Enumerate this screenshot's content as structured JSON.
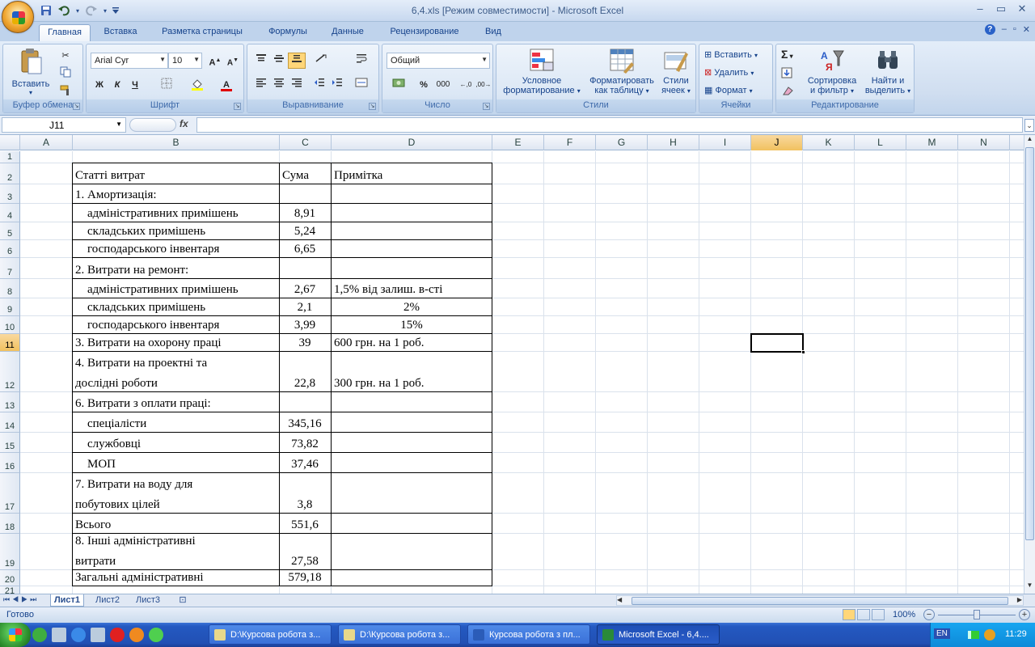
{
  "window": {
    "title": "6,4.xls  [Режим совместимости] - Microsoft Excel",
    "qat_icons": [
      "save-icon",
      "undo-icon",
      "redo-icon",
      "customize-icon"
    ]
  },
  "tabs": [
    "Главная",
    "Вставка",
    "Разметка страницы",
    "Формулы",
    "Данные",
    "Рецензирование",
    "Вид"
  ],
  "ribbon": {
    "clipboard": {
      "paste": "Вставить",
      "label": "Буфер обмена"
    },
    "font": {
      "name": "Arial Cyr",
      "size": "10",
      "bold": "Ж",
      "italic": "К",
      "underline": "Ч",
      "label": "Шрифт"
    },
    "alignment": {
      "label": "Выравнивание"
    },
    "number": {
      "format": "Общий",
      "percent": "%",
      "thousands": "000",
      "label": "Число"
    },
    "styles": {
      "conditional1": "Условное",
      "conditional2": "форматирование",
      "format_table1": "Форматировать",
      "format_table2": "как таблицу",
      "cell_styles1": "Стили",
      "cell_styles2": "ячеек",
      "label": "Стили"
    },
    "cells": {
      "insert": "Вставить",
      "delete": "Удалить",
      "format": "Формат",
      "label": "Ячейки"
    },
    "editing": {
      "sum": "Σ",
      "sort1": "Сортировка",
      "sort2": "и фильтр",
      "find1": "Найти и",
      "find2": "выделить",
      "label": "Редактирование"
    }
  },
  "formula_bar": {
    "name_box": "J11",
    "fx": "fx",
    "value": ""
  },
  "columns": [
    "A",
    "B",
    "C",
    "D",
    "E",
    "F",
    "G",
    "H",
    "I",
    "J",
    "K",
    "L",
    "M",
    "N"
  ],
  "rows": [
    "1",
    "2",
    "3",
    "4",
    "5",
    "6",
    "7",
    "8",
    "9",
    "10",
    "11",
    "12",
    "13",
    "14",
    "15",
    "16",
    "17",
    "18",
    "19",
    "20",
    "21"
  ],
  "cells": {
    "r2": {
      "b": "Статті витрат",
      "c": "Сума",
      "d": "Примітка"
    },
    "r3": {
      "b": "1. Амортизація:",
      "c": "",
      "d": ""
    },
    "r4": {
      "b": "адміністративних примішень",
      "c": "8,91",
      "d": ""
    },
    "r5": {
      "b": "складських примішень",
      "c": "5,24",
      "d": ""
    },
    "r6": {
      "b": "господарського інвентаря",
      "c": "6,65",
      "d": ""
    },
    "r7": {
      "b": "2. Витрати на ремонт:",
      "c": "",
      "d": ""
    },
    "r8": {
      "b": "адміністративних примішень",
      "c": "2,67",
      "d": "1,5% від залиш. в-сті"
    },
    "r9": {
      "b": "складських примішень",
      "c": "2,1",
      "d": "2%"
    },
    "r10": {
      "b": "господарського інвентаря",
      "c": "3,99",
      "d": "15%"
    },
    "r11": {
      "b": "3. Витрати на охорону праці",
      "c": "39",
      "d": "600 грн. на 1 роб."
    },
    "r12": {
      "b1": "4. Витрати на проектні та",
      "b2": "дослідні роботи",
      "c": "22,8",
      "d": "300 грн. на 1 роб."
    },
    "r13": {
      "b": "6. Витрати з оплати праці:",
      "c": "",
      "d": ""
    },
    "r14": {
      "b": "спеціалісти",
      "c": "345,16",
      "d": ""
    },
    "r15": {
      "b": "службовці",
      "c": "73,82",
      "d": ""
    },
    "r16": {
      "b": "МОП",
      "c": "37,46",
      "d": ""
    },
    "r17": {
      "b1": "7. Витрати на воду для",
      "b2": "побутових цілей",
      "c": "3,8",
      "d": ""
    },
    "r18": {
      "b": "Всього",
      "c": "551,6",
      "d": ""
    },
    "r19": {
      "b1": "8. Інші адміністративні",
      "b2": "витрати",
      "c": "27,58",
      "d": ""
    },
    "r20": {
      "b": "Загальні адміністративні",
      "c": "579,18",
      "d": ""
    }
  },
  "sheets": [
    "Лист1",
    "Лист2",
    "Лист3"
  ],
  "status": {
    "ready": "Готово",
    "zoom": "100%"
  },
  "taskbar": {
    "items": [
      "D:\\Курсова робота з...",
      "D:\\Курсова робота з...",
      "Курсова робота з пл...",
      "Microsoft Excel - 6,4...."
    ],
    "lang": "EN",
    "time": "11:29"
  },
  "colors": {
    "selected_header": "#f1c15f",
    "accent": "#15428b"
  }
}
